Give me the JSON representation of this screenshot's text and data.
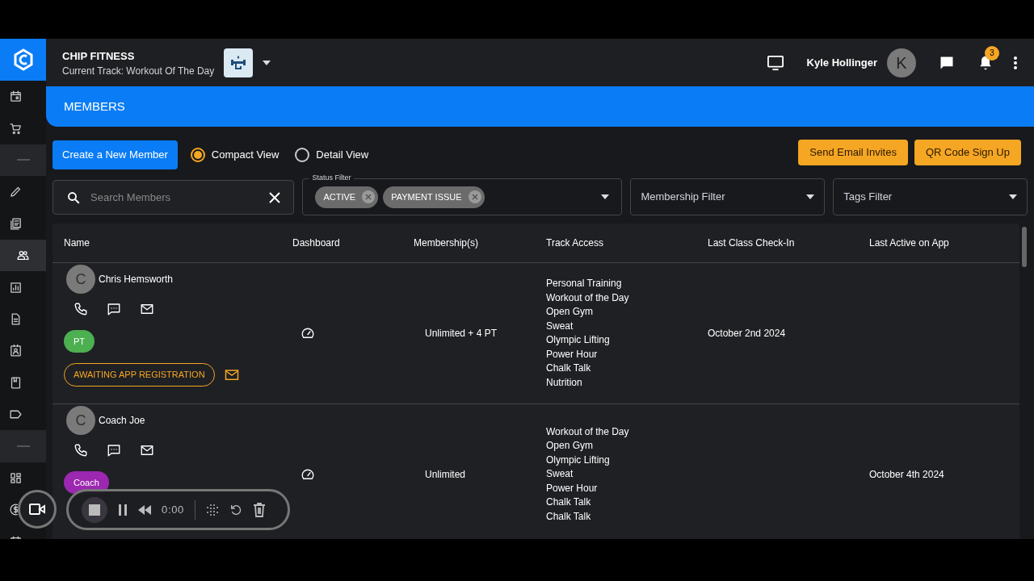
{
  "sidebar": {
    "items": [
      {
        "kind": "calendar",
        "selected": false
      },
      {
        "kind": "cart",
        "selected": false
      },
      {
        "kind": "divider",
        "selected": false
      },
      {
        "kind": "pencil",
        "selected": false
      },
      {
        "kind": "news",
        "selected": false
      },
      {
        "kind": "people",
        "selected": true
      },
      {
        "kind": "chart",
        "selected": false
      },
      {
        "kind": "document",
        "selected": false
      },
      {
        "kind": "contact",
        "selected": false
      },
      {
        "kind": "book",
        "selected": false
      },
      {
        "kind": "tag",
        "selected": false
      },
      {
        "kind": "divider",
        "selected": false
      },
      {
        "kind": "dashboard",
        "selected": false
      },
      {
        "kind": "dollar",
        "selected": false
      },
      {
        "kind": "calendar",
        "selected": false
      }
    ]
  },
  "header": {
    "brand": "CHIP FITNESS",
    "track": "Current Track: Workout Of The Day",
    "user": "Kyle Hollinger",
    "avatar": "K",
    "notifications": "3"
  },
  "page_title": "MEMBERS",
  "create_button": "Create a New Member",
  "view_options": [
    {
      "label": "Compact View",
      "selected": true
    },
    {
      "label": "Detail View",
      "selected": false
    }
  ],
  "action_buttons": [
    "Send Email Invites",
    "QR Code Sign Up"
  ],
  "search": {
    "placeholder": "Search Members"
  },
  "status_filter": {
    "label": "Status Filter",
    "chips": [
      "ACTIVE",
      "PAYMENT ISSUE"
    ]
  },
  "membership_filter": {
    "placeholder": "Membership Filter"
  },
  "tags_filter": {
    "placeholder": "Tags Filter"
  },
  "table": {
    "columns": [
      "Name",
      "Dashboard",
      "Membership(s)",
      "Track Access",
      "Last Class Check-In",
      "Last Active on App"
    ],
    "rows": [
      {
        "avatar": "C",
        "name": "Chris Hemsworth",
        "tags": [
          {
            "label": "PT",
            "color": "#4caf50"
          }
        ],
        "status": "AWAITING APP REGISTRATION",
        "membership": "Unlimited + 4 PT",
        "tracks": [
          "Personal Training",
          "Workout of the Day",
          "Open Gym",
          "Sweat",
          "Olympic Lifting",
          "Power Hour",
          "Chalk Talk",
          "Nutrition"
        ],
        "last_check_in": "October 2nd 2024"
      },
      {
        "avatar": "C",
        "name": "Coach Joe",
        "tags": [
          {
            "label": "Coach",
            "color": "#9c27b0"
          }
        ],
        "membership": "Unlimited",
        "tracks": [
          "Workout of the Day",
          "Open Gym",
          "Olympic Lifting",
          "Sweat",
          "Power Hour",
          "Chalk Talk",
          "Chalk Talk"
        ],
        "last_active": "October 4th 2024"
      }
    ]
  },
  "recorder": {
    "time": "0:00"
  }
}
